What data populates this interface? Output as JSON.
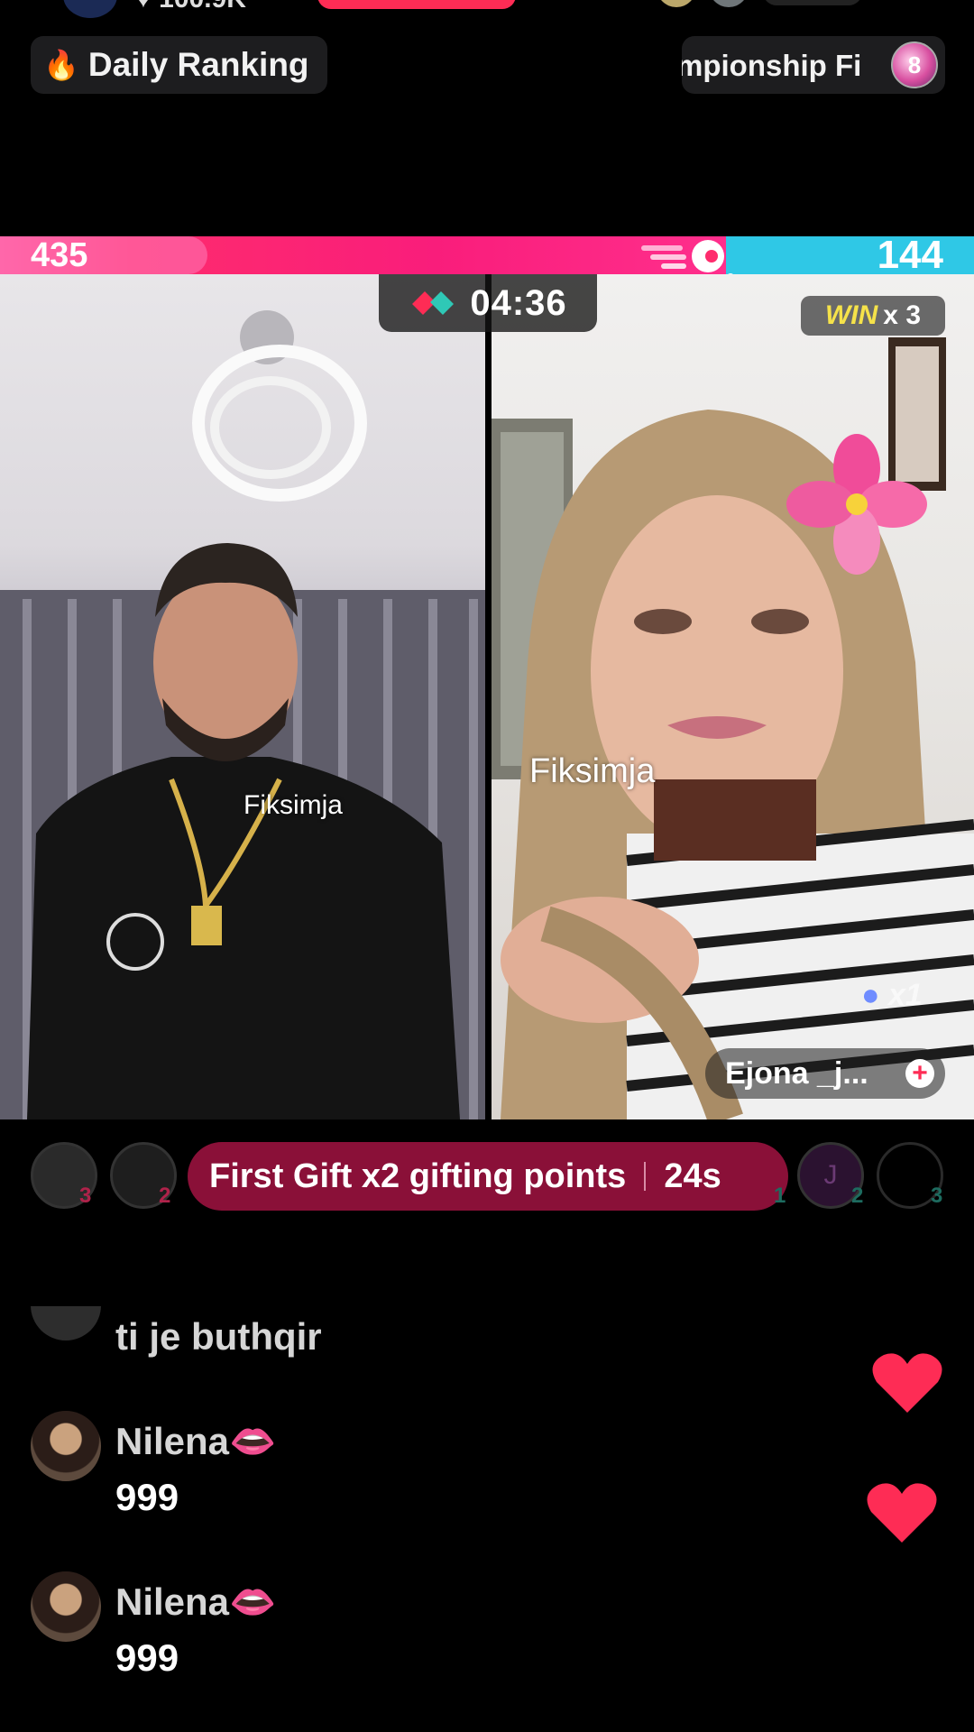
{
  "top_bar": {
    "likes": "100.9K",
    "daily_ranking_label": "Daily Ranking",
    "championship_label": "mpionship Fi",
    "championship_badge": "8"
  },
  "battle": {
    "left_score": "435",
    "right_score": "144",
    "timer": "04:36",
    "win_label": "WIN",
    "win_multiplier": "x 3",
    "left_overlay_name": "Fiksimja",
    "right_overlay_name": "Fiksimja",
    "right_host_name": "Ejona _j...",
    "right_gift_combo": "x1",
    "colors": {
      "left": "#fe2c6d",
      "right": "#2fc8e6"
    }
  },
  "gift_row": {
    "banner_text": "First Gift x2 gifting points",
    "banner_timer": "24s",
    "left_ranks": [
      "3",
      "2"
    ],
    "right_ranks": [
      "1",
      "2",
      "3"
    ],
    "right_avatar_letter": "J"
  },
  "chat": [
    {
      "name": "",
      "message": "ti je buthqir"
    },
    {
      "name": "Nilena",
      "emoji": "👄",
      "message": "999"
    },
    {
      "name": "Nilena",
      "emoji": "👄",
      "message": "999"
    }
  ]
}
